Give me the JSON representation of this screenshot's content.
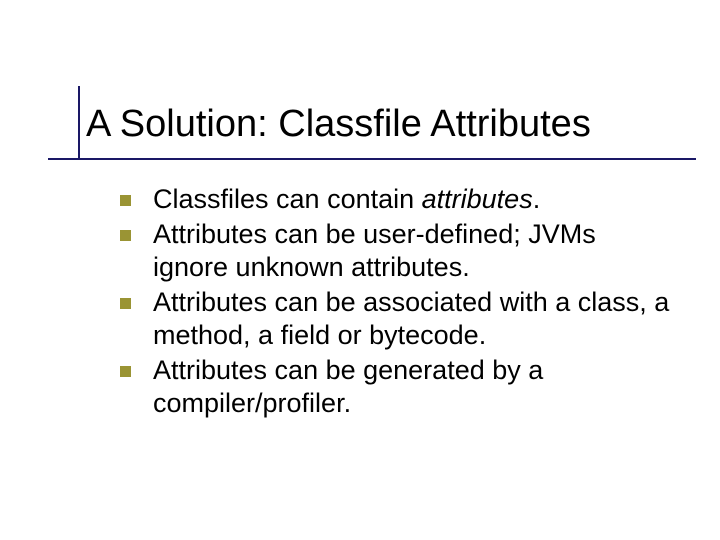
{
  "slide": {
    "title": "A Solution: Classfile Attributes",
    "bullets": [
      {
        "pre": "Classfiles can contain ",
        "em": "attributes",
        "post": "."
      },
      {
        "pre": "Attributes can be user-defined; JVMs ignore unknown attributes.",
        "em": "",
        "post": ""
      },
      {
        "pre": "Attributes can be associated with a class, a method, a field or bytecode.",
        "em": "",
        "post": ""
      },
      {
        "pre": "Attributes can be generated by a compiler/profiler.",
        "em": "",
        "post": ""
      }
    ]
  }
}
